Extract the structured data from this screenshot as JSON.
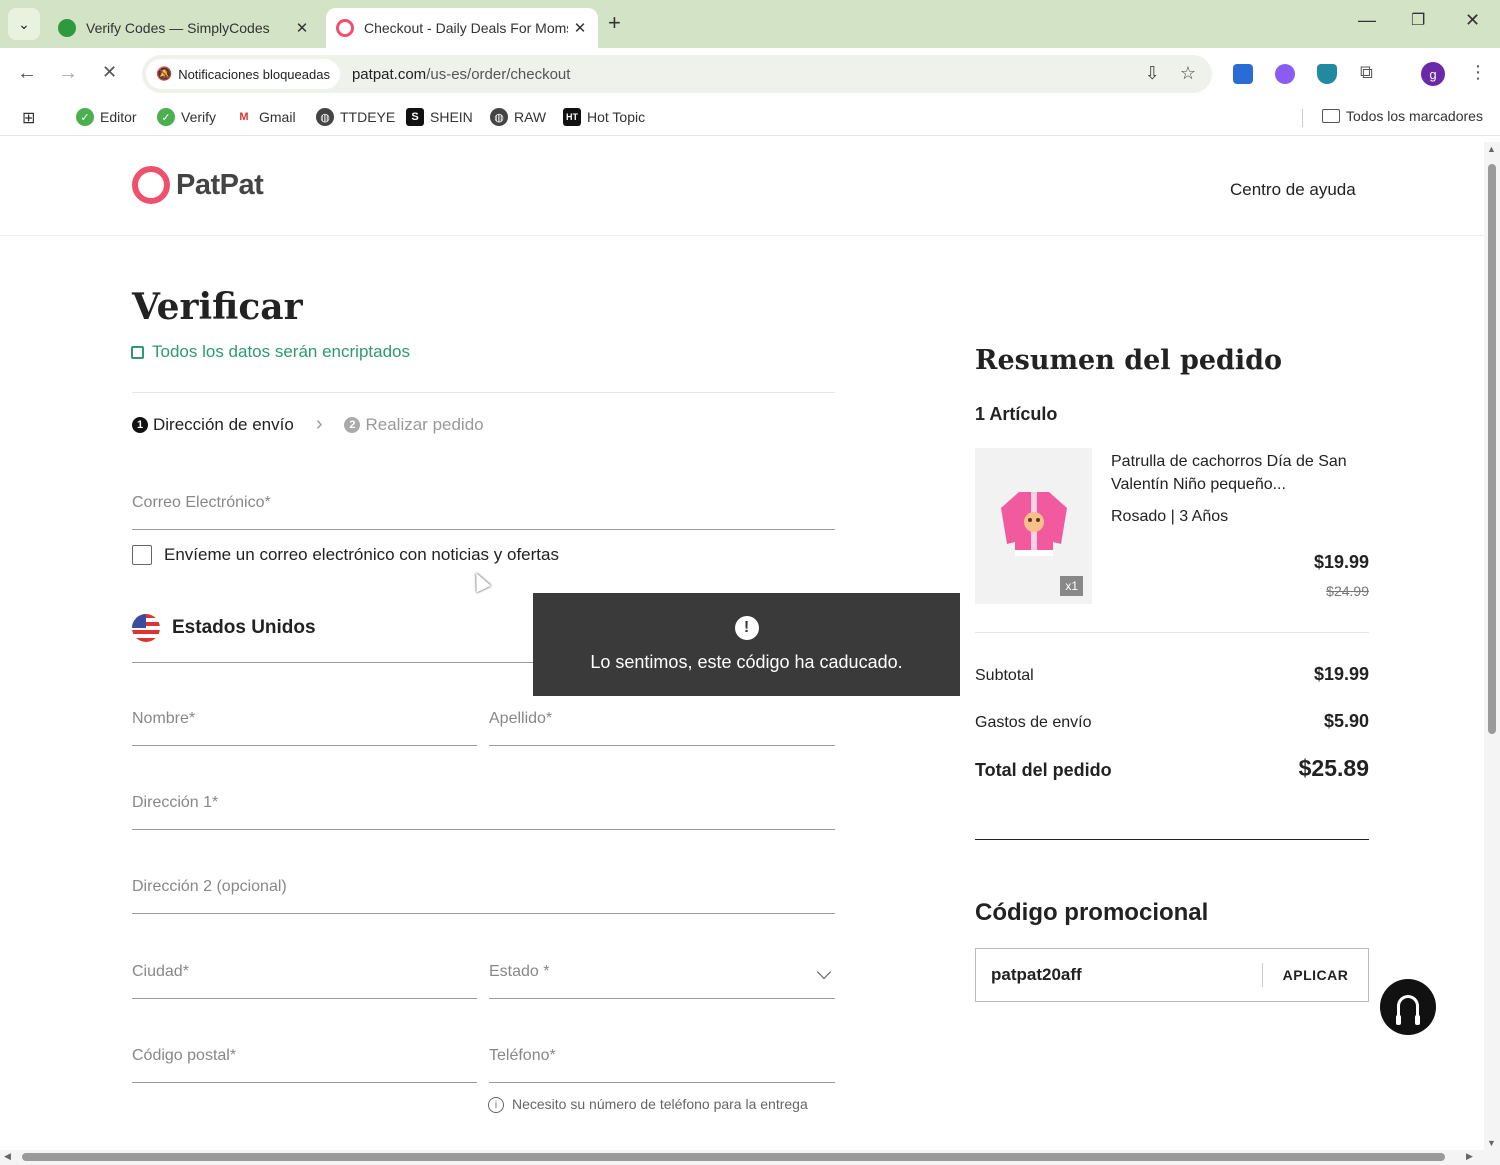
{
  "browser": {
    "tabs": [
      {
        "title": "Verify Codes — SimplyCodes",
        "favicon_color": "#2e9a3e"
      },
      {
        "title": "Checkout - Daily Deals For Moms",
        "favicon_color": "#f0506e"
      }
    ],
    "notification_chip": "Notificaciones bloqueadas",
    "url_domain": "patpat.com",
    "url_path": "/us-es/order/checkout",
    "profile_initial": "g",
    "bookmarks": [
      "Editor",
      "Verify",
      "Gmail",
      "TTDEYE",
      "SHEIN",
      "RAW",
      "Hot Topic"
    ],
    "bookmark_icons": {
      "shein": "S",
      "hottopic": "HT"
    },
    "all_bookmarks": "Todos los marcadores"
  },
  "site": {
    "logo": "PatPat",
    "help": "Centro de ayuda"
  },
  "checkout": {
    "title": "Verificar",
    "encrypted": "Todos los datos serán encriptados",
    "steps": [
      {
        "num": "1",
        "label": "Dirección de envío"
      },
      {
        "num": "2",
        "label": "Realizar pedido"
      }
    ],
    "email": "Correo Electrónico*",
    "newsletter": "Envíeme un correo electrónico con noticias y ofertas",
    "country": "Estados Unidos",
    "first_name": "Nombre*",
    "last_name": "Apellido*",
    "address1": "Dirección 1*",
    "address2": "Dirección 2 (opcional)",
    "city": "Ciudad*",
    "state": "Estado *",
    "zip": "Código postal*",
    "phone": "Teléfono*",
    "phone_note": "Necesito su número de teléfono para la entrega"
  },
  "summary": {
    "title": "Resumen del pedido",
    "count": "1 Artículo",
    "product": {
      "name": "Patrulla de cachorros Día de San Valentín Niño pequeño...",
      "variant": "Rosado | 3 Años",
      "price": "$19.99",
      "original": "$24.99",
      "qty": "x1"
    },
    "subtotal_label": "Subtotal",
    "subtotal": "$19.99",
    "shipping_label": "Gastos de envío",
    "shipping": "$5.90",
    "total_label": "Total del pedido",
    "total": "$25.89"
  },
  "promo": {
    "title": "Código promocional",
    "value": "patpat20aff",
    "apply": "APLICAR"
  },
  "toast": {
    "icon": "!",
    "message": "Lo sentimos, este código ha caducado."
  },
  "colors": {
    "brand": "#f0506e",
    "accent_green": "#2e9a6e",
    "toast_bg": "#3a3a3a"
  }
}
